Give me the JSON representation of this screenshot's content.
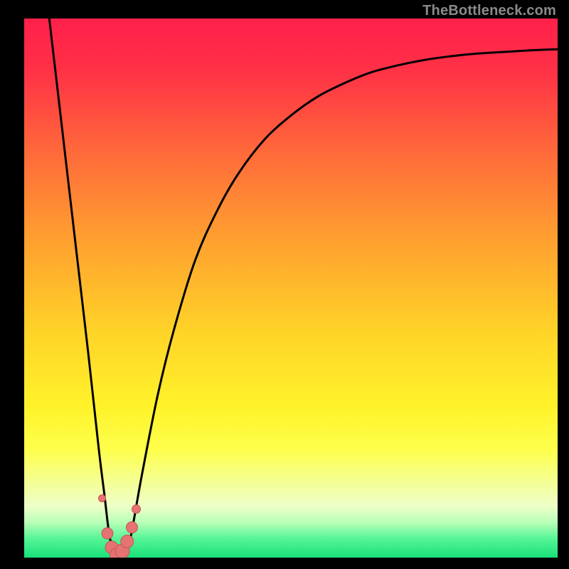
{
  "watermark": "TheBottleneck.com",
  "colors": {
    "frame": "#000000",
    "curve": "#000000",
    "marker_fill": "#e57373",
    "marker_stroke": "#c9564f",
    "gradient_stops": [
      {
        "offset": 0.0,
        "color": "#ff1f4a"
      },
      {
        "offset": 0.1,
        "color": "#ff3246"
      },
      {
        "offset": 0.25,
        "color": "#ff6a3a"
      },
      {
        "offset": 0.42,
        "color": "#ffa32f"
      },
      {
        "offset": 0.58,
        "color": "#ffd328"
      },
      {
        "offset": 0.72,
        "color": "#fff22a"
      },
      {
        "offset": 0.8,
        "color": "#feff4c"
      },
      {
        "offset": 0.86,
        "color": "#f4ff95"
      },
      {
        "offset": 0.905,
        "color": "#edffc8"
      },
      {
        "offset": 0.935,
        "color": "#b7ffb7"
      },
      {
        "offset": 0.965,
        "color": "#55f596"
      },
      {
        "offset": 1.0,
        "color": "#18e07a"
      }
    ]
  },
  "chart_data": {
    "type": "line",
    "title": "",
    "xlabel": "",
    "ylabel": "",
    "xlim": [
      0,
      100
    ],
    "ylim": [
      0,
      100
    ],
    "series": [
      {
        "name": "bottleneck-curve",
        "x": [
          4.7,
          6,
          8,
          10,
          12,
          14,
          15,
          16,
          17,
          18,
          19,
          20,
          22,
          25,
          28,
          32,
          36,
          40,
          45,
          50,
          55,
          60,
          65,
          70,
          75,
          80,
          85,
          90,
          95,
          100
        ],
        "y": [
          100,
          89,
          72,
          55,
          38,
          20,
          12,
          4,
          1,
          0.5,
          1,
          4,
          15,
          30,
          42,
          55,
          64,
          71,
          77.5,
          82,
          85.5,
          88,
          90,
          91.3,
          92.3,
          93,
          93.5,
          93.8,
          94.1,
          94.3
        ]
      }
    ],
    "markers": {
      "name": "highlight-dots",
      "points": [
        {
          "x": 14.6,
          "y": 11.0,
          "r": 5
        },
        {
          "x": 15.6,
          "y": 4.5,
          "r": 8
        },
        {
          "x": 16.4,
          "y": 1.9,
          "r": 9
        },
        {
          "x": 17.4,
          "y": 0.5,
          "r": 10
        },
        {
          "x": 18.4,
          "y": 1.2,
          "r": 10
        },
        {
          "x": 19.3,
          "y": 3.0,
          "r": 9
        },
        {
          "x": 20.2,
          "y": 5.6,
          "r": 8
        },
        {
          "x": 21.0,
          "y": 9.0,
          "r": 6
        }
      ]
    }
  }
}
